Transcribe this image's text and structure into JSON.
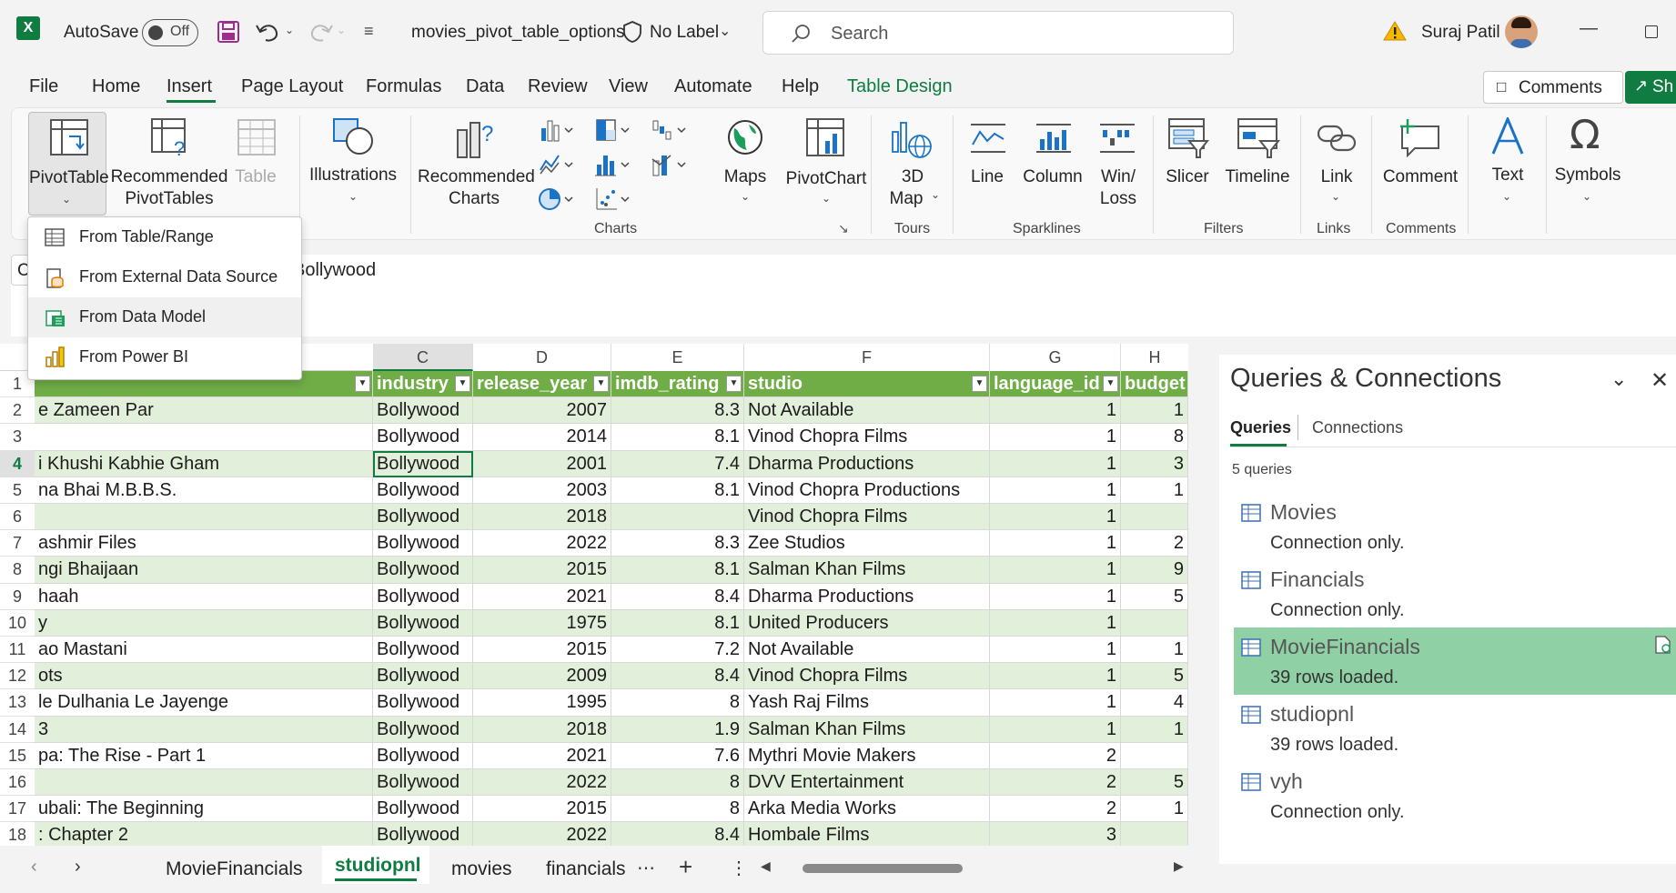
{
  "title_bar": {
    "autosave_label": "AutoSave",
    "autosave_state": "Off",
    "file_name": "movies_pivot_table_options",
    "sensitivity_label": "No Label",
    "search_placeholder": "Search",
    "user_name": "Suraj Patil"
  },
  "menu_tabs": [
    "File",
    "Home",
    "Insert",
    "Page Layout",
    "Formulas",
    "Data",
    "Review",
    "View",
    "Automate",
    "Help",
    "Table Design"
  ],
  "active_tab": "Insert",
  "header_buttons": {
    "comments": "Comments",
    "share": "Sh"
  },
  "ribbon": {
    "pivottable": "PivotTable",
    "recommended_pivottables_1": "Recommended",
    "recommended_pivottables_2": "PivotTables",
    "table": "Table",
    "illustrations": "Illustrations",
    "recommended_charts_1": "Recommended",
    "recommended_charts_2": "Charts",
    "maps": "Maps",
    "pivotchart": "PivotChart",
    "map3d_1": "3D",
    "map3d_2": "Map",
    "line": "Line",
    "column": "Column",
    "winloss_1": "Win/",
    "winloss_2": "Loss",
    "slicer": "Slicer",
    "timeline": "Timeline",
    "link": "Link",
    "comment": "Comment",
    "text": "Text",
    "symbols": "Symbols",
    "groups": {
      "charts": "Charts",
      "tours": "Tours",
      "sparklines": "Sparklines",
      "filters": "Filters",
      "links": "Links",
      "comments": "Comments"
    }
  },
  "pivot_menu": {
    "items": [
      {
        "label": "From Table/Range"
      },
      {
        "label": "From External Data Source"
      },
      {
        "label": "From Data Model"
      },
      {
        "label": "From Power BI"
      }
    ]
  },
  "formula_bar": {
    "name_box": "C",
    "content": "Bollywood"
  },
  "grid": {
    "columns": [
      "C",
      "D",
      "E",
      "F",
      "G",
      "H"
    ],
    "headers": [
      "industry",
      "release_year",
      "imdb_rating",
      "studio",
      "language_id",
      "budget"
    ],
    "rows": [
      {
        "n": "1"
      },
      {
        "n": "2",
        "a": "e Zameen Par",
        "c": "Bollywood",
        "d": "2007",
        "e": "8.3",
        "f": "Not Available",
        "g": "1",
        "h": "1"
      },
      {
        "n": "3",
        "a": "",
        "c": "Bollywood",
        "d": "2014",
        "e": "8.1",
        "f": "Vinod Chopra Films",
        "g": "1",
        "h": "8"
      },
      {
        "n": "4",
        "a": "i Khushi Kabhie Gham",
        "c": "Bollywood",
        "d": "2001",
        "e": "7.4",
        "f": "Dharma Productions",
        "g": "1",
        "h": "3"
      },
      {
        "n": "5",
        "a": "na Bhai M.B.B.S.",
        "c": "Bollywood",
        "d": "2003",
        "e": "8.1",
        "f": "Vinod Chopra Productions",
        "g": "1",
        "h": "1"
      },
      {
        "n": "6",
        "a": "",
        "c": "Bollywood",
        "d": "2018",
        "e": "",
        "f": "Vinod Chopra Films",
        "g": "1",
        "h": ""
      },
      {
        "n": "7",
        "a": "ashmir Files",
        "c": "Bollywood",
        "d": "2022",
        "e": "8.3",
        "f": "Zee Studios",
        "g": "1",
        "h": "2"
      },
      {
        "n": "8",
        "a": "ngi Bhaijaan",
        "c": "Bollywood",
        "d": "2015",
        "e": "8.1",
        "f": "Salman Khan Films",
        "g": "1",
        "h": "9"
      },
      {
        "n": "9",
        "a": "haah",
        "c": "Bollywood",
        "d": "2021",
        "e": "8.4",
        "f": "Dharma Productions",
        "g": "1",
        "h": "5"
      },
      {
        "n": "10",
        "a": "y",
        "c": "Bollywood",
        "d": "1975",
        "e": "8.1",
        "f": "United Producers",
        "g": "1",
        "h": ""
      },
      {
        "n": "11",
        "a": "ao Mastani",
        "c": "Bollywood",
        "d": "2015",
        "e": "7.2",
        "f": "Not Available",
        "g": "1",
        "h": "1"
      },
      {
        "n": "12",
        "a": "ots",
        "c": "Bollywood",
        "d": "2009",
        "e": "8.4",
        "f": "Vinod Chopra Films",
        "g": "1",
        "h": "5"
      },
      {
        "n": "13",
        "a": "le Dulhania Le Jayenge",
        "c": "Bollywood",
        "d": "1995",
        "e": "8",
        "f": "Yash Raj Films",
        "g": "1",
        "h": "4"
      },
      {
        "n": "14",
        "a": "3",
        "c": "Bollywood",
        "d": "2018",
        "e": "1.9",
        "f": "Salman Khan Films",
        "g": "1",
        "h": "1"
      },
      {
        "n": "15",
        "a": "pa: The Rise - Part 1",
        "c": "Bollywood",
        "d": "2021",
        "e": "7.6",
        "f": "Mythri Movie Makers",
        "g": "2",
        "h": ""
      },
      {
        "n": "16",
        "a": "",
        "c": "Bollywood",
        "d": "2022",
        "e": "8",
        "f": "DVV Entertainment",
        "g": "2",
        "h": "5"
      },
      {
        "n": "17",
        "a": "ubali: The Beginning",
        "c": "Bollywood",
        "d": "2015",
        "e": "8",
        "f": "Arka Media Works",
        "g": "2",
        "h": "1"
      },
      {
        "n": "18",
        "a": ": Chapter 2",
        "c": "Bollywood",
        "d": "2022",
        "e": "8.4",
        "f": "Hombale Films",
        "g": "3",
        "h": ""
      }
    ]
  },
  "queries_pane": {
    "title": "Queries & Connections",
    "tabs": [
      "Queries",
      "Connections"
    ],
    "count_label": "5 queries",
    "queries": [
      {
        "name": "Movies",
        "status": "Connection only."
      },
      {
        "name": "Financials",
        "status": "Connection only."
      },
      {
        "name": "MovieFinancials",
        "status": "39 rows loaded."
      },
      {
        "name": "studiopnl",
        "status": "39 rows loaded."
      },
      {
        "name": "vyh",
        "status": "Connection only."
      }
    ]
  },
  "sheet_tabs": [
    "MovieFinancials",
    "studiopnl",
    "movies",
    "financials"
  ],
  "active_sheet": "studiopnl",
  "colors": {
    "accent": "#107c41",
    "table_header": "#70ad47",
    "band": "#e2efda",
    "highlight": "#8fd0a5"
  }
}
